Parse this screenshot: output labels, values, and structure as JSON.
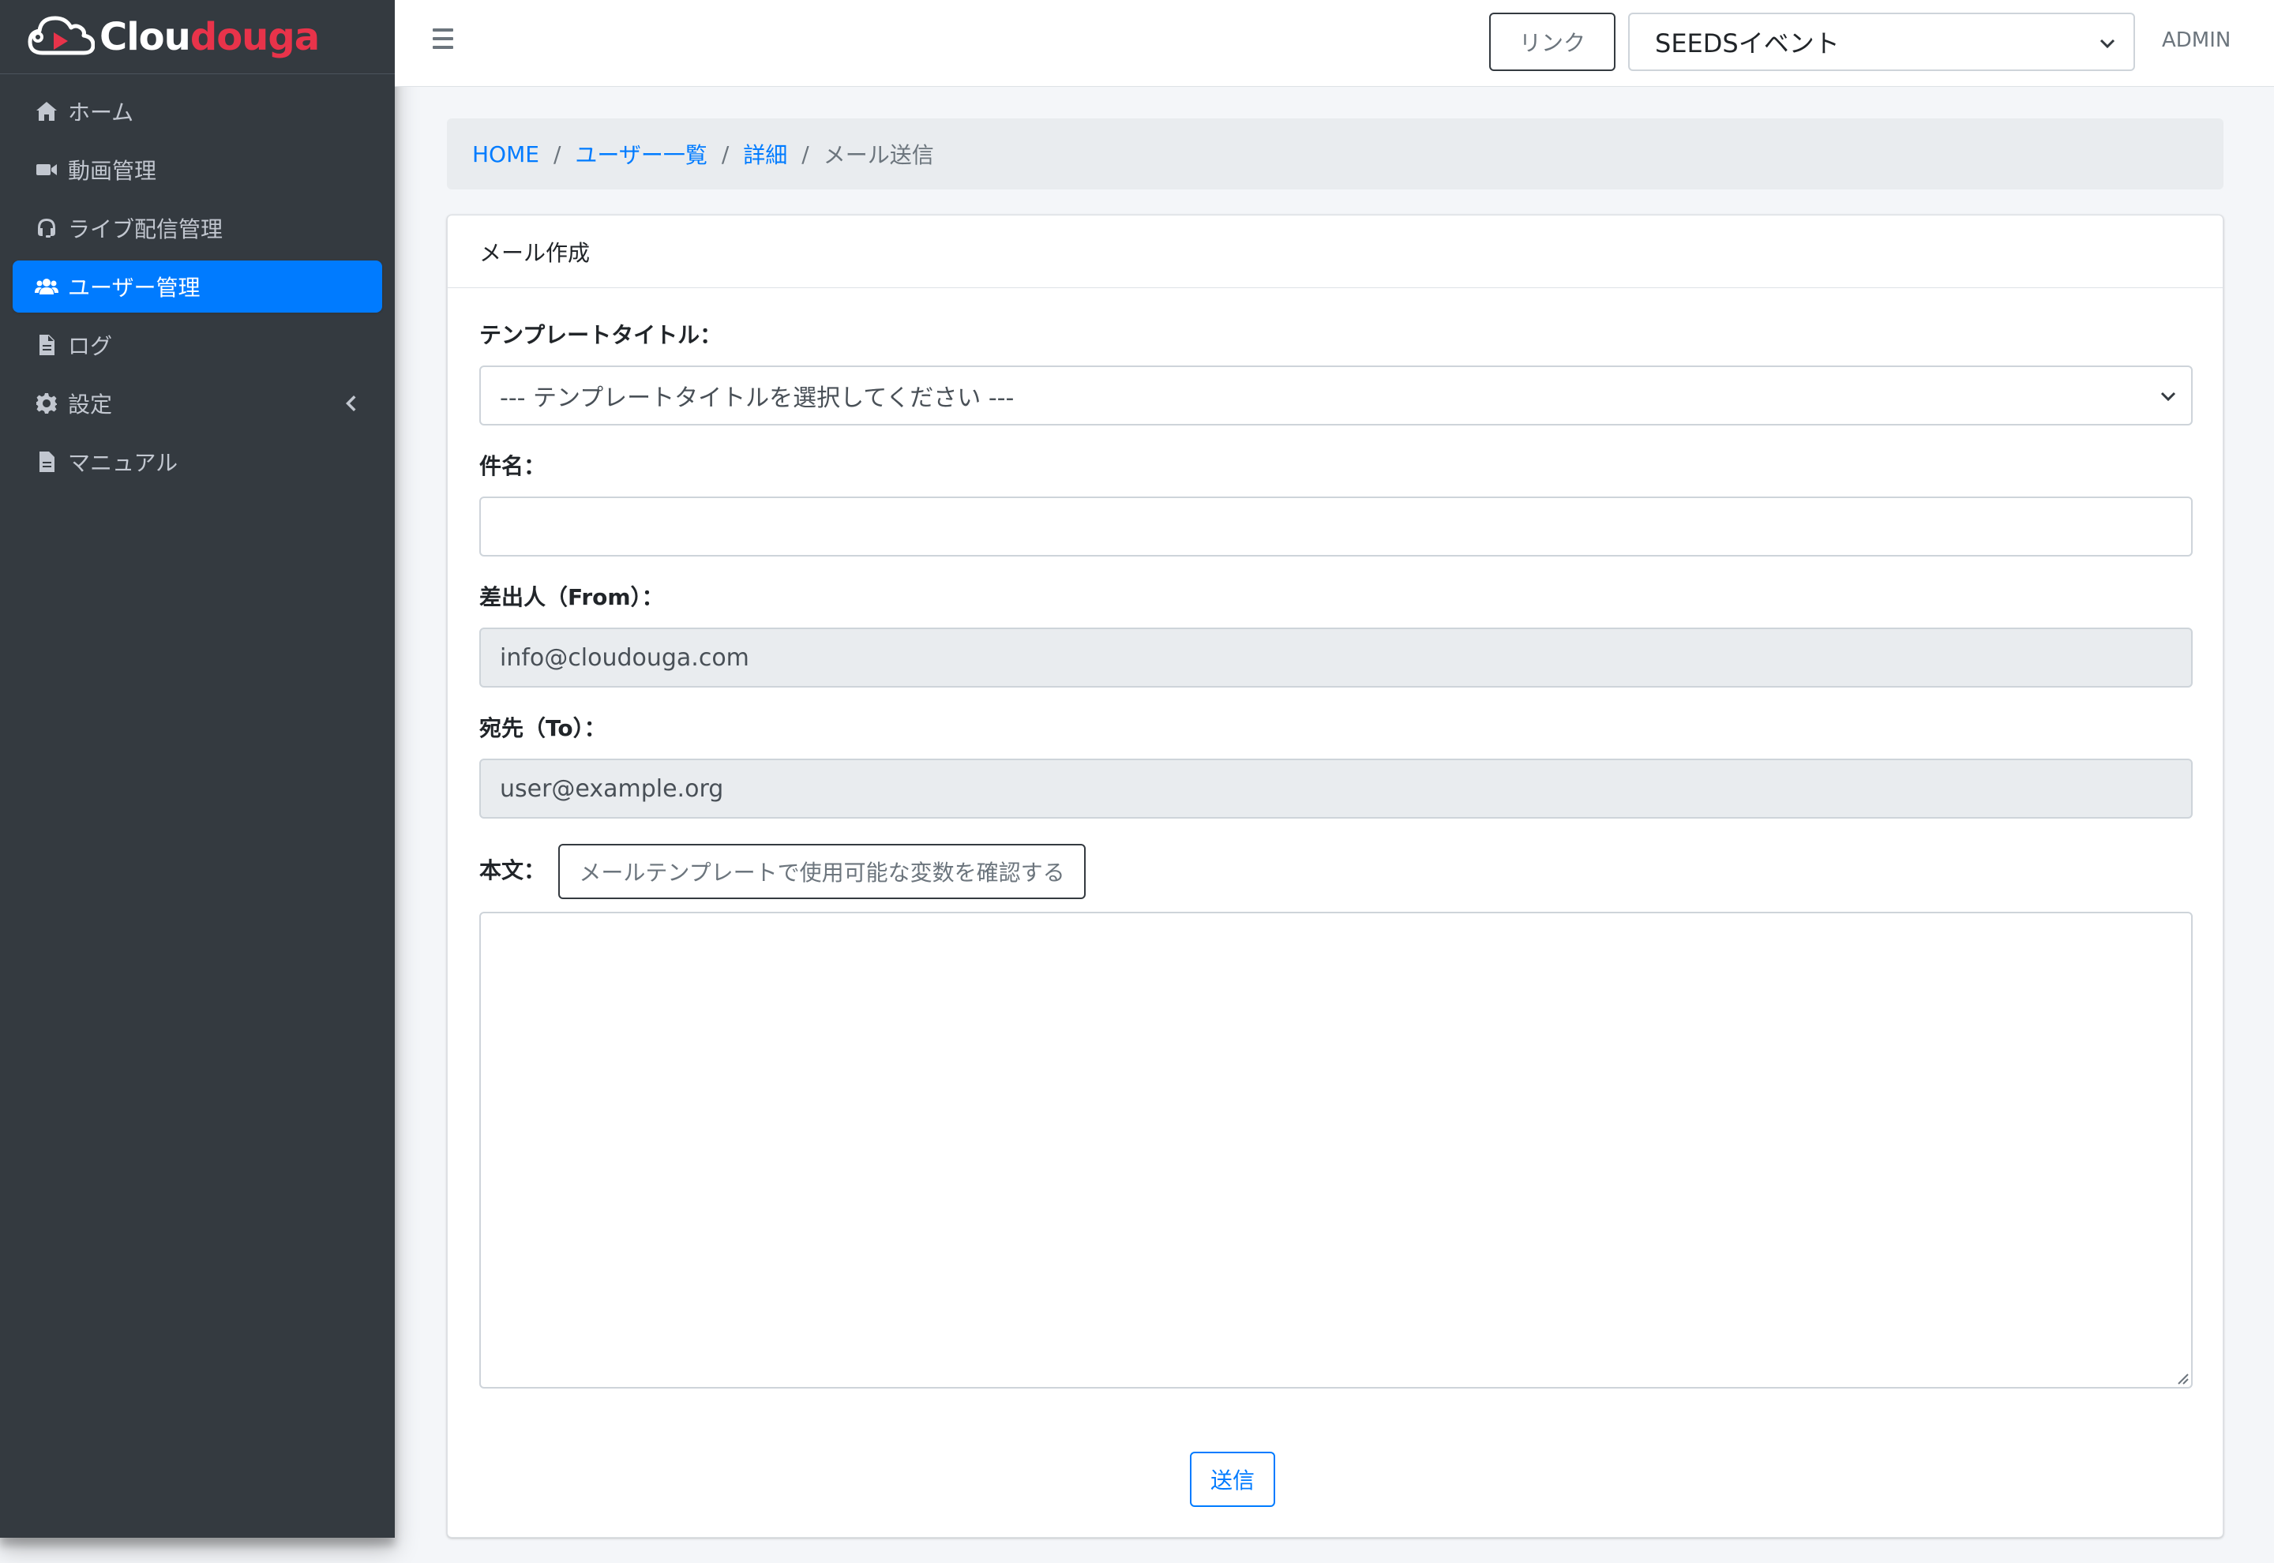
{
  "brand": {
    "part1": "Clou",
    "part2": "douga"
  },
  "sidebar": {
    "items": [
      {
        "label": "ホーム",
        "icon": "home-icon"
      },
      {
        "label": "動画管理",
        "icon": "video-icon"
      },
      {
        "label": "ライブ配信管理",
        "icon": "headset-icon"
      },
      {
        "label": "ユーザー管理",
        "icon": "users-icon",
        "active": true
      },
      {
        "label": "ログ",
        "icon": "file-icon"
      },
      {
        "label": "設定",
        "icon": "gear-icon"
      },
      {
        "label": "マニュアル",
        "icon": "file-icon"
      }
    ]
  },
  "topbar": {
    "link_label": "リンク",
    "event_selected": "SEEDSイベント",
    "user": "ADMIN"
  },
  "breadcrumb": {
    "home": "HOME",
    "users": "ユーザー一覧",
    "detail": "詳細",
    "current": "メール送信",
    "separator": "/"
  },
  "card": {
    "title": "メール作成",
    "template_label": "テンプレートタイトル：",
    "template_placeholder": "--- テンプレートタイトルを選択してください ---",
    "subject_label": "件名：",
    "subject_value": "",
    "from_label": "差出人（From）：",
    "from_value": "info@cloudouga.com",
    "to_label": "宛先（To）：",
    "to_value": "user@example.org",
    "body_label": "本文：",
    "variables_button": "メールテンプレートで使用可能な変数を確認する",
    "body_value": "",
    "send_button": "送信"
  },
  "colors": {
    "sidebar_bg": "#343a40",
    "accent": "#007bff",
    "brand_red": "#e8334a"
  }
}
